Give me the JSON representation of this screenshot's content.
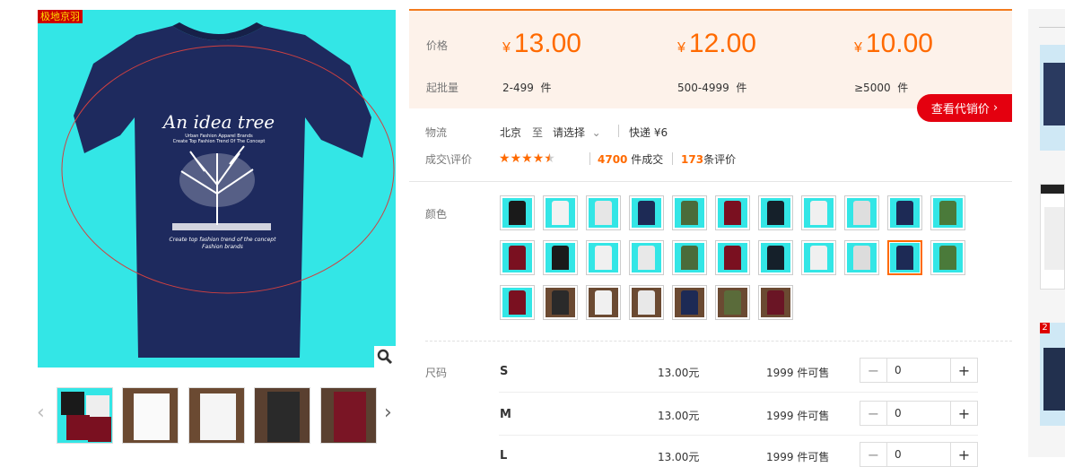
{
  "main_image": {
    "brand_tag": "极地京羽",
    "shirt_title": "An idea tree",
    "shirt_sub1": "Urban Fashion Apparel Brands",
    "shirt_sub2": "Create Top Fashion Trend Of The Concept",
    "shirt_sub3": "Create top fashion trend of the concept",
    "shirt_sub4": "Fashion brands"
  },
  "price": {
    "price_label": "价格",
    "min_label": "起批量",
    "tiers": [
      {
        "currency": "¥",
        "amount": "13.00",
        "range": "2-499",
        "unit": "件"
      },
      {
        "currency": "¥",
        "amount": "12.00",
        "range": "500-4999",
        "unit": "件"
      },
      {
        "currency": "¥",
        "amount": "10.00",
        "range": "≥5000",
        "unit": "件"
      }
    ],
    "agent_button": "查看代销价"
  },
  "logistics": {
    "label": "物流",
    "from": "北京",
    "to_word": "至",
    "select": "请选择",
    "express": "快递 ¥6"
  },
  "deals": {
    "label": "成交\\评价",
    "rating": 4.5,
    "sold_count": "4700",
    "sold_suffix": "件成交",
    "review_count": "173",
    "review_suffix": "条评价"
  },
  "color": {
    "label": "颜色",
    "selected_index": 20,
    "swatch_colors": [
      "#1a1a1a",
      "#f2f2f2",
      "#e6e6e6",
      "#1d2a55",
      "#4a6b3a",
      "#7a1020",
      "#15202a",
      "#f0f0f0",
      "#dedede",
      "#1d2a55",
      "#4a7a3a",
      "#7a1020",
      "#1a1a1a",
      "#f0f0f0",
      "#e8e8e8",
      "#4a6b3a",
      "#7a1020",
      "#15202a",
      "#f0f0f0",
      "#dcdcdc",
      "#1d2a55",
      "#4a7a3a",
      "#7a1020",
      "#2a2a2a",
      "#f0f0f0",
      "#e8e8e8",
      "#1d2a55",
      "#5a6b3a",
      "#6a1525"
    ]
  },
  "sizes": {
    "label": "尺码",
    "rows": [
      {
        "size": "S",
        "price": "13.00元",
        "stock": "1999 件可售",
        "qty": "0"
      },
      {
        "size": "M",
        "price": "13.00元",
        "stock": "1999 件可售",
        "qty": "0"
      },
      {
        "size": "L",
        "price": "13.00元",
        "stock": "1999 件可售",
        "qty": "0"
      }
    ]
  },
  "side_badges": [
    "2"
  ]
}
